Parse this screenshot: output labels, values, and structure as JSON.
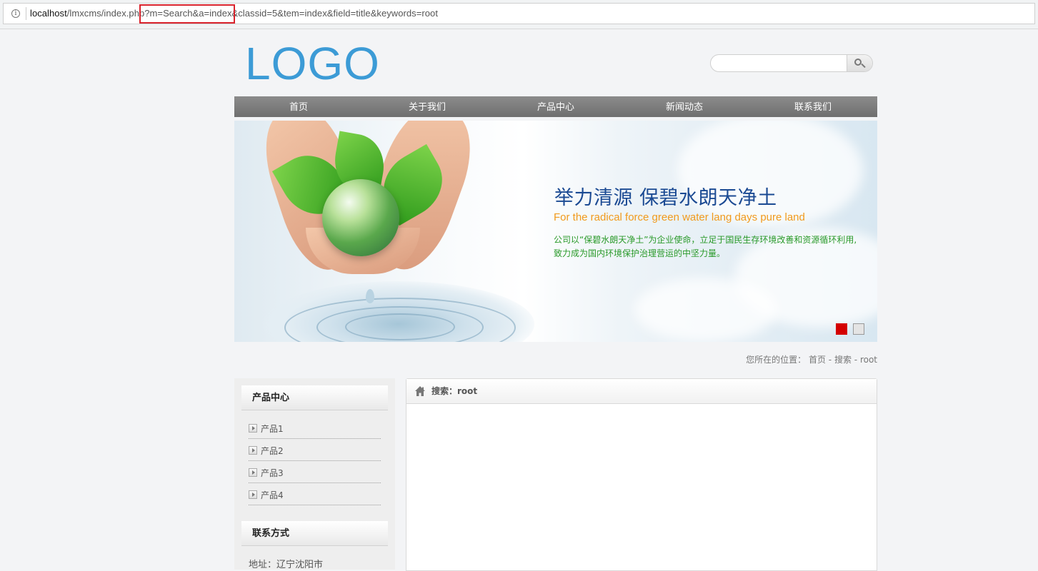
{
  "browser": {
    "url_host": "localhost",
    "url_path": "/lmxcms/index.php?m=Search&a=index&classid=5&tem=index&field=title&keywords=root"
  },
  "header": {
    "logo": "LOGO",
    "search_placeholder": ""
  },
  "nav": {
    "items": [
      "首页",
      "关于我们",
      "产品中心",
      "新闻动态",
      "联系我们"
    ]
  },
  "banner": {
    "title": "举力清源 保碧水朗天净土",
    "subtitle": "For the radical force green water lang days pure land",
    "text_line1": "公司以“保碧水朗天净土”为企业使命，立足于国民生存环境改善和资源循环利用,",
    "text_line2": "致力成为国内环境保护治理营运的中坚力量。",
    "active_slide": 1,
    "slide_count": 2
  },
  "breadcrumb": {
    "prefix": "您所在的位置：",
    "home": "首页",
    "sep": " - ",
    "current": "搜索",
    "keyword": "root"
  },
  "sidebar": {
    "products_title": "产品中心",
    "products": [
      "产品1",
      "产品2",
      "产品3",
      "产品4"
    ],
    "contact_title": "联系方式",
    "address": "地址：辽宁沈阳市"
  },
  "main": {
    "title": "搜索：root"
  },
  "colors": {
    "logo": "#3c9bd6",
    "nav_bg": "#7d7d7d",
    "slide_active": "#d40000",
    "url_highlight": "#d9232d"
  }
}
